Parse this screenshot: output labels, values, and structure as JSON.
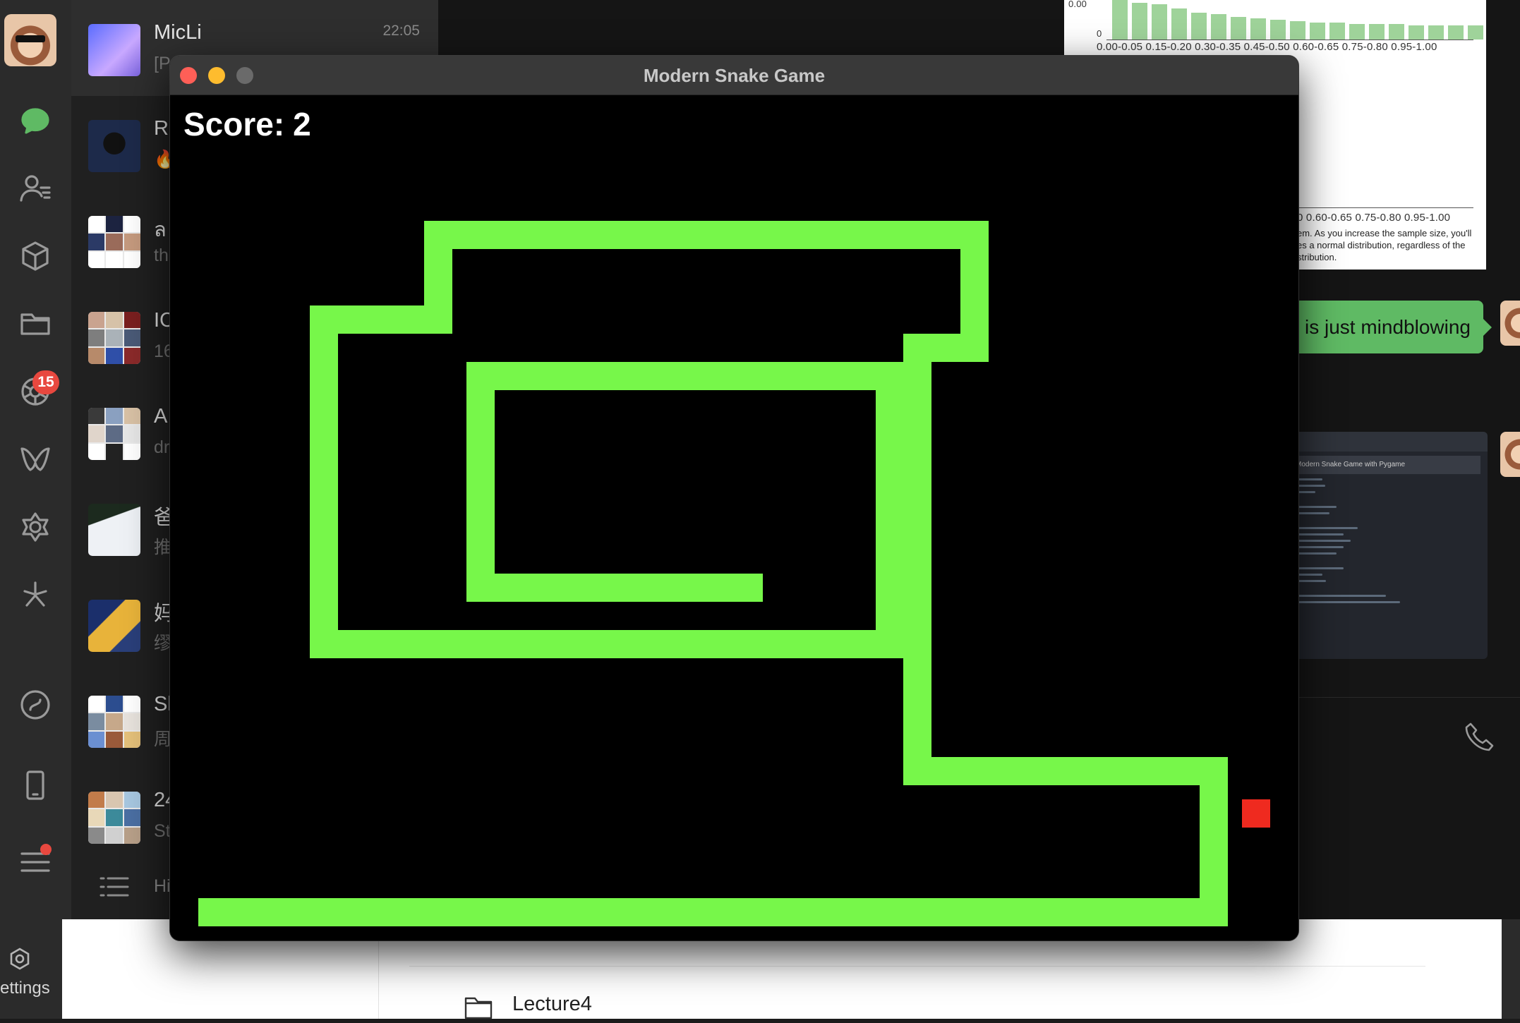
{
  "chat": {
    "contacts": [
      {
        "name": "MicLi",
        "preview": "[P",
        "time": "22:05"
      },
      {
        "name": "Ri",
        "preview": "🔥",
        "time": ""
      },
      {
        "name": "ล",
        "preview": "th",
        "time": ""
      },
      {
        "name": "IC",
        "preview": "16",
        "time": ""
      },
      {
        "name": "A",
        "preview": "dr",
        "time": ""
      },
      {
        "name": "爸",
        "preview": "推",
        "time": ""
      },
      {
        "name": "妈",
        "preview": "缪",
        "time": ""
      },
      {
        "name": "Sl",
        "preview": "周",
        "time": ""
      },
      {
        "name": "24",
        "preview": "St",
        "time": ""
      }
    ],
    "footer_label": "Hi",
    "moments_badge": "15",
    "message_bubble": "is just mindblowing",
    "chart_ticks_top": "0.00-0.05   0.15-0.20   0.30-0.35   0.45-0.50   0.60-0.65   0.75-0.80      0.95-1.00",
    "chart_ticks_bottom": "0   0.60-0.65   0.75-0.80      0.95-1.00",
    "chart_axis_zero": "0",
    "chart_axis_top": "0.00",
    "chart_caption": "em. As you increase the sample size, you'll es a normal distribution, regardless of the stribution.",
    "code_title": "Modern Snake Game with Pygame"
  },
  "bottom_app": {
    "settings_label": "ettings",
    "folder_label": "Lecture4"
  },
  "game": {
    "window_title": "Modern Snake Game",
    "score_label": "Score:",
    "score_value": "2",
    "colors": {
      "snake": "#77f74a",
      "food": "#ef2a1f",
      "background": "#000000"
    },
    "traffic_light_colors": {
      "close": "#ff5f57",
      "minimize": "#febc2e",
      "zoom": "#6a6a6a"
    }
  }
}
